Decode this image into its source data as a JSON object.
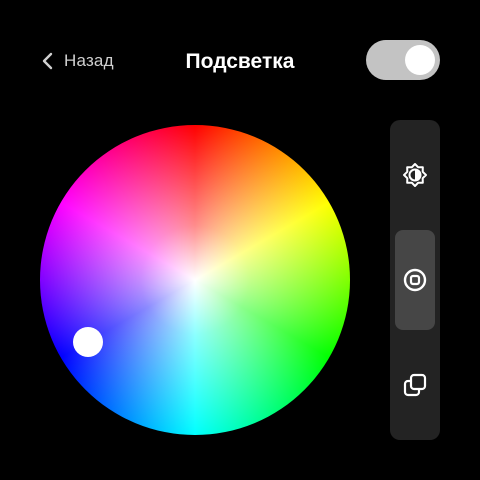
{
  "header": {
    "back_label": "Назад",
    "title": "Подсветка",
    "power_toggle": {
      "on": true
    }
  },
  "color_wheel": {
    "selected_hue_deg": 240,
    "selected_saturation": 0.8
  },
  "mode_panel": {
    "items": [
      {
        "name": "brightness",
        "icon": "brightness-icon",
        "active": false
      },
      {
        "name": "solid-color",
        "icon": "target-square-icon",
        "active": true
      },
      {
        "name": "layers",
        "icon": "layers-icon",
        "active": false
      }
    ]
  },
  "colors": {
    "background": "#000000",
    "panel": "#232323",
    "panel_active": "#464646",
    "toggle_track": "#c3c3c3",
    "text_secondary": "#d0d0d0",
    "text_primary": "#ffffff"
  }
}
